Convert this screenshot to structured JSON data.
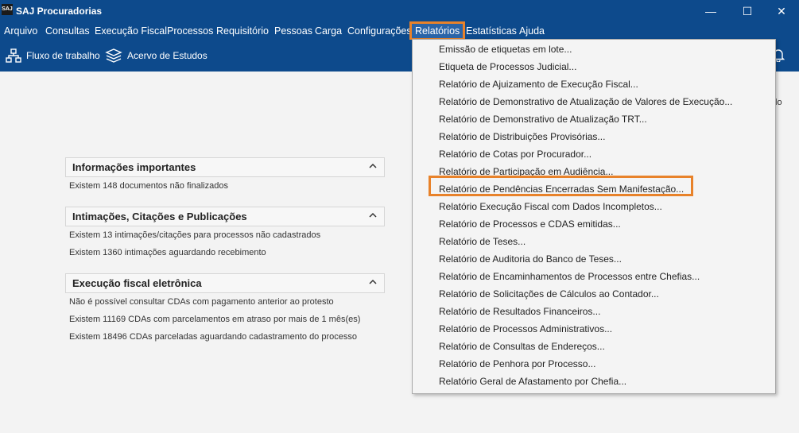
{
  "app": {
    "icon_text": "SAJ",
    "title": "SAJ Procuradorias"
  },
  "window_controls": {
    "minimize": "—",
    "maximize": "☐",
    "close": "✕"
  },
  "menubar": [
    {
      "label": "Arquivo"
    },
    {
      "label": "Consultas"
    },
    {
      "label": "Execução Fiscal"
    },
    {
      "label": "Processos"
    },
    {
      "label": "Requisitório"
    },
    {
      "label": "Pessoas"
    },
    {
      "label": "Carga"
    },
    {
      "label": "Configurações"
    },
    {
      "label": "Relatórios"
    },
    {
      "label": "Estatísticas"
    },
    {
      "label": "Ajuda"
    }
  ],
  "toolbar": {
    "workflow": "Fluxo de trabalho",
    "studies": "Acervo de Estudos"
  },
  "right_partial_label": "lo",
  "panels": [
    {
      "title": "Informações importantes",
      "lines": [
        "Existem  148 documentos não finalizados"
      ]
    },
    {
      "title": "Intimações, Citações e Publicações",
      "lines": [
        "Existem  13 intimações/citações para processos não cadastrados",
        "Existem  1360 intimações aguardando recebimento"
      ]
    },
    {
      "title": "Execução fiscal eletrônica",
      "lines": [
        "Não é possível consultar CDAs com pagamento anterior ao protesto",
        "Existem  11169 CDAs com parcelamentos em atraso por mais de 1 mês(es)",
        "Existem  18496 CDAs parceladas aguardando cadastramento do processo"
      ]
    }
  ],
  "dropdown": [
    "Emissão de etiquetas em lote...",
    "Etiqueta de Processos Judicial...",
    "Relatório de Ajuizamento de Execução Fiscal...",
    "Relatório de Demonstrativo de Atualização de Valores de Execução...",
    "Relatório de Demonstrativo de Atualização TRT...",
    "Relatório de Distribuições Provisórias...",
    "Relatório de Cotas por Procurador...",
    "Relatório de Participação em Audiência...",
    "Relatório de Pendências Encerradas Sem Manifestação...",
    "Relatório Execução Fiscal com Dados Incompletos...",
    "Relatório de Processos e CDAS emitidas...",
    "Relatório de Teses...",
    "Relatório de Auditoria do Banco de Teses...",
    "Relatório de Encaminhamentos de Processos entre Chefias...",
    "Relatório de Solicitações de Cálculos ao Contador...",
    "Relatório de Resultados Financeiros...",
    "Relatório de Processos Administrativos...",
    "Relatório de Consultas de Endereços...",
    "Relatório de Penhora por Processo...",
    "Relatório Geral de Afastamento por Chefia..."
  ]
}
